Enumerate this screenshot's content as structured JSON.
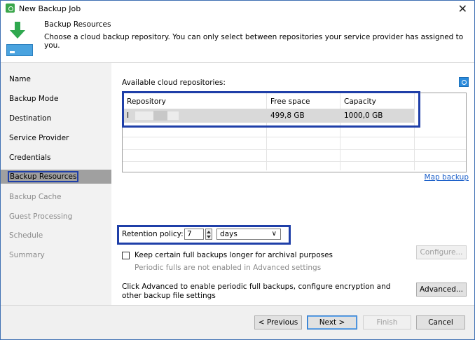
{
  "window": {
    "title": "New Backup Job"
  },
  "header": {
    "title": "Backup Resources",
    "description": "Choose a cloud backup repository. You can only select between repositories your service provider has assigned to you."
  },
  "sidebar": {
    "items": [
      {
        "label": "Name",
        "state": "completed"
      },
      {
        "label": "Backup Mode",
        "state": "completed"
      },
      {
        "label": "Destination",
        "state": "completed"
      },
      {
        "label": "Service Provider",
        "state": "completed"
      },
      {
        "label": "Credentials",
        "state": "completed"
      },
      {
        "label": "Backup Resources",
        "state": "active"
      },
      {
        "label": "Backup Cache",
        "state": "disabled"
      },
      {
        "label": "Guest Processing",
        "state": "disabled"
      },
      {
        "label": "Schedule",
        "state": "disabled"
      },
      {
        "label": "Summary",
        "state": "disabled"
      }
    ]
  },
  "main": {
    "available_label": "Available cloud repositories:",
    "refresh_icon": "refresh-icon",
    "table": {
      "headers": [
        "Repository",
        "Free space",
        "Capacity"
      ],
      "rows": [
        {
          "repository": "I",
          "free_space": "499,8 GB",
          "capacity": "1000,0 GB",
          "selected": true
        }
      ]
    },
    "map_backup_link": "Map backup",
    "retention": {
      "label": "Retention policy:",
      "value": "7",
      "unit": "days",
      "unit_chevron": "∨"
    },
    "keep_full_checkbox": {
      "label": "Keep certain full backups longer for archival purposes",
      "checked": false
    },
    "periodic_note": "Periodic fulls are not enabled in Advanced settings",
    "configure_button": "Configure...",
    "advanced_note": "Click Advanced to enable periodic full backups, configure encryption and other backup file settings",
    "advanced_button": "Advanced..."
  },
  "footer": {
    "previous": "< Previous",
    "next": "Next >",
    "finish": "Finish",
    "cancel": "Cancel"
  },
  "colors": {
    "highlight_border": "#1f3fa8",
    "link": "#1b5fc9",
    "accent_green": "#2fa84f",
    "selected_row": "#d9d9d9",
    "active_nav": "#a0a0a0"
  }
}
